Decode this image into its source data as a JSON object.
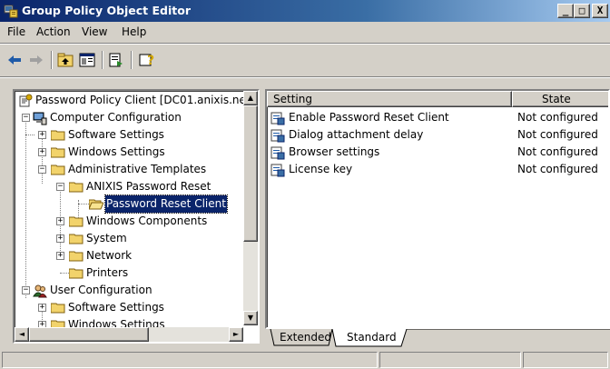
{
  "window": {
    "title": "Group Policy Object Editor",
    "controls": {
      "minimize": "_",
      "maximize": "□",
      "close": "X"
    }
  },
  "menu": {
    "items": [
      {
        "label": "File"
      },
      {
        "label": "Action"
      },
      {
        "label": "View"
      },
      {
        "label": "Help"
      }
    ]
  },
  "toolbar": {
    "buttons": [
      "back-arrow-icon",
      "forward-arrow-icon",
      "up-folder-icon",
      "show-hide-tree-icon",
      "export-list-icon",
      "help-icon"
    ]
  },
  "tree": {
    "items": [
      {
        "label": "Password Policy Client [DC01.anixis.ne"
      },
      {
        "label": "Computer Configuration",
        "expander": "−"
      },
      {
        "label": "Software Settings",
        "expander": "+"
      },
      {
        "label": "Windows Settings",
        "expander": "+"
      },
      {
        "label": "Administrative Templates",
        "expander": "−"
      },
      {
        "label": "ANIXIS Password Reset",
        "expander": "−"
      },
      {
        "label": "Password Reset Client",
        "selected": true
      },
      {
        "label": "Windows Components",
        "expander": "+"
      },
      {
        "label": "System",
        "expander": "+"
      },
      {
        "label": "Network",
        "expander": "+"
      },
      {
        "label": "Printers"
      },
      {
        "label": "User Configuration",
        "expander": "−"
      },
      {
        "label": "Software Settings",
        "expander": "+"
      },
      {
        "label": "Windows Settings",
        "expander": "+"
      }
    ]
  },
  "list": {
    "columns": [
      "Setting",
      "State"
    ],
    "rows": [
      {
        "setting": "Enable Password Reset Client",
        "state": "Not configured"
      },
      {
        "setting": "Dialog attachment delay",
        "state": "Not configured"
      },
      {
        "setting": "Browser settings",
        "state": "Not configured"
      },
      {
        "setting": "License key",
        "state": "Not configured"
      }
    ]
  },
  "tabs": [
    {
      "label": "Extended"
    },
    {
      "label": "Standard",
      "active": true
    }
  ],
  "scroll": {
    "up": "▲",
    "down": "▼",
    "left": "◄",
    "right": "►"
  },
  "colors": {
    "title_start": "#0a246a",
    "title_end": "#a6caf0",
    "face": "#d4d0c8",
    "selection": "#0a246a"
  }
}
